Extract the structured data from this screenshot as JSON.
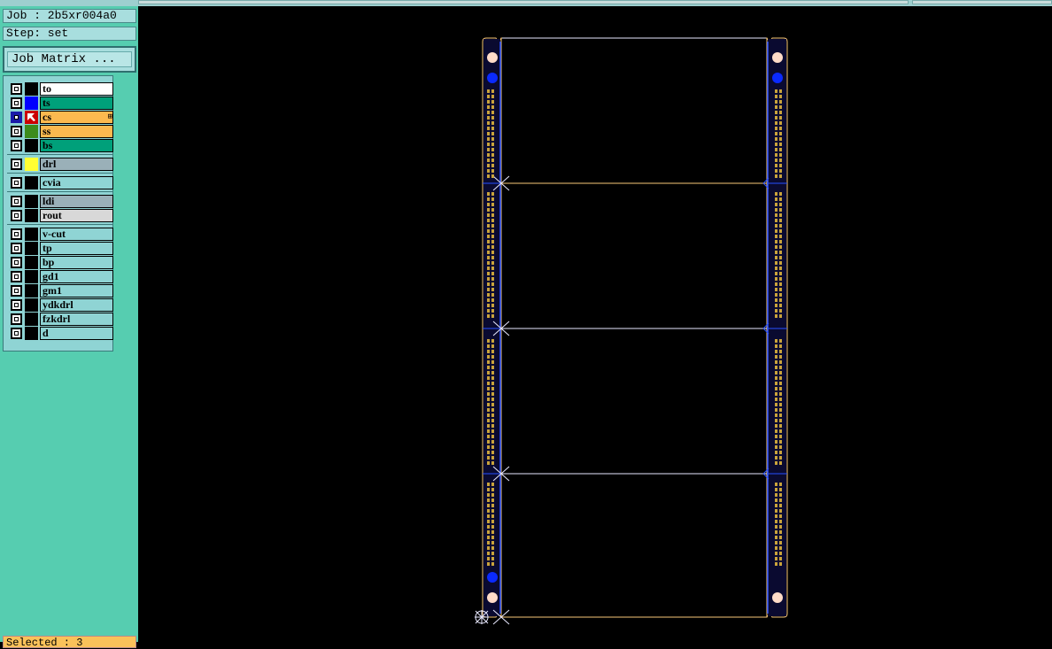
{
  "job": {
    "label": "Job : 2b5xr004a0"
  },
  "step": {
    "label": "Step: set"
  },
  "job_matrix": {
    "label": "Job Matrix ..."
  },
  "layers": [
    {
      "name": "to",
      "color": "#000000",
      "bg": "#ffffff",
      "selected": false
    },
    {
      "name": "ts",
      "color": "#0000ff",
      "bg": "#00a07a",
      "selected": false
    },
    {
      "name": "cs",
      "color": "#cc0000",
      "bg": "#fbb94f",
      "selected": true
    },
    {
      "name": "ss",
      "color": "#3c8c1c",
      "bg": "#fbb94f",
      "selected": false
    },
    {
      "name": "bs",
      "color": "#000000",
      "bg": "#00a07a",
      "selected": false
    },
    {
      "name": "drl",
      "color": "#ffff33",
      "bg": "#9ab0b8",
      "selected": false
    },
    {
      "name": "cvia",
      "color": "#000000",
      "bg": "#8fd4d4",
      "selected": false
    },
    {
      "name": "ldi",
      "color": "#000000",
      "bg": "#9ab0b8",
      "selected": false
    },
    {
      "name": "rout",
      "color": "#000000",
      "bg": "#d8d8d8",
      "selected": false
    },
    {
      "name": "v-cut",
      "color": "#000000",
      "bg": "#8fd4d4",
      "selected": false
    },
    {
      "name": "tp",
      "color": "#000000",
      "bg": "#8fd4d4",
      "selected": false
    },
    {
      "name": "bp",
      "color": "#000000",
      "bg": "#8fd4d4",
      "selected": false
    },
    {
      "name": "gd1",
      "color": "#000000",
      "bg": "#8fd4d4",
      "selected": false
    },
    {
      "name": "gm1",
      "color": "#000000",
      "bg": "#8fd4d4",
      "selected": false
    },
    {
      "name": "ydkdrl",
      "color": "#000000",
      "bg": "#8fd4d4",
      "selected": false
    },
    {
      "name": "fzkdrl",
      "color": "#000000",
      "bg": "#8fd4d4",
      "selected": false
    },
    {
      "name": "d",
      "color": "#000000",
      "bg": "#8fd4d4",
      "selected": false
    }
  ],
  "status": {
    "label": "Selected : 3"
  },
  "colors": {
    "panel": "#56cdb0",
    "outline": "#f9c777",
    "pads": "#c9a33c",
    "vcut": "#2850ff",
    "fiducial": "#ffdcc8"
  }
}
